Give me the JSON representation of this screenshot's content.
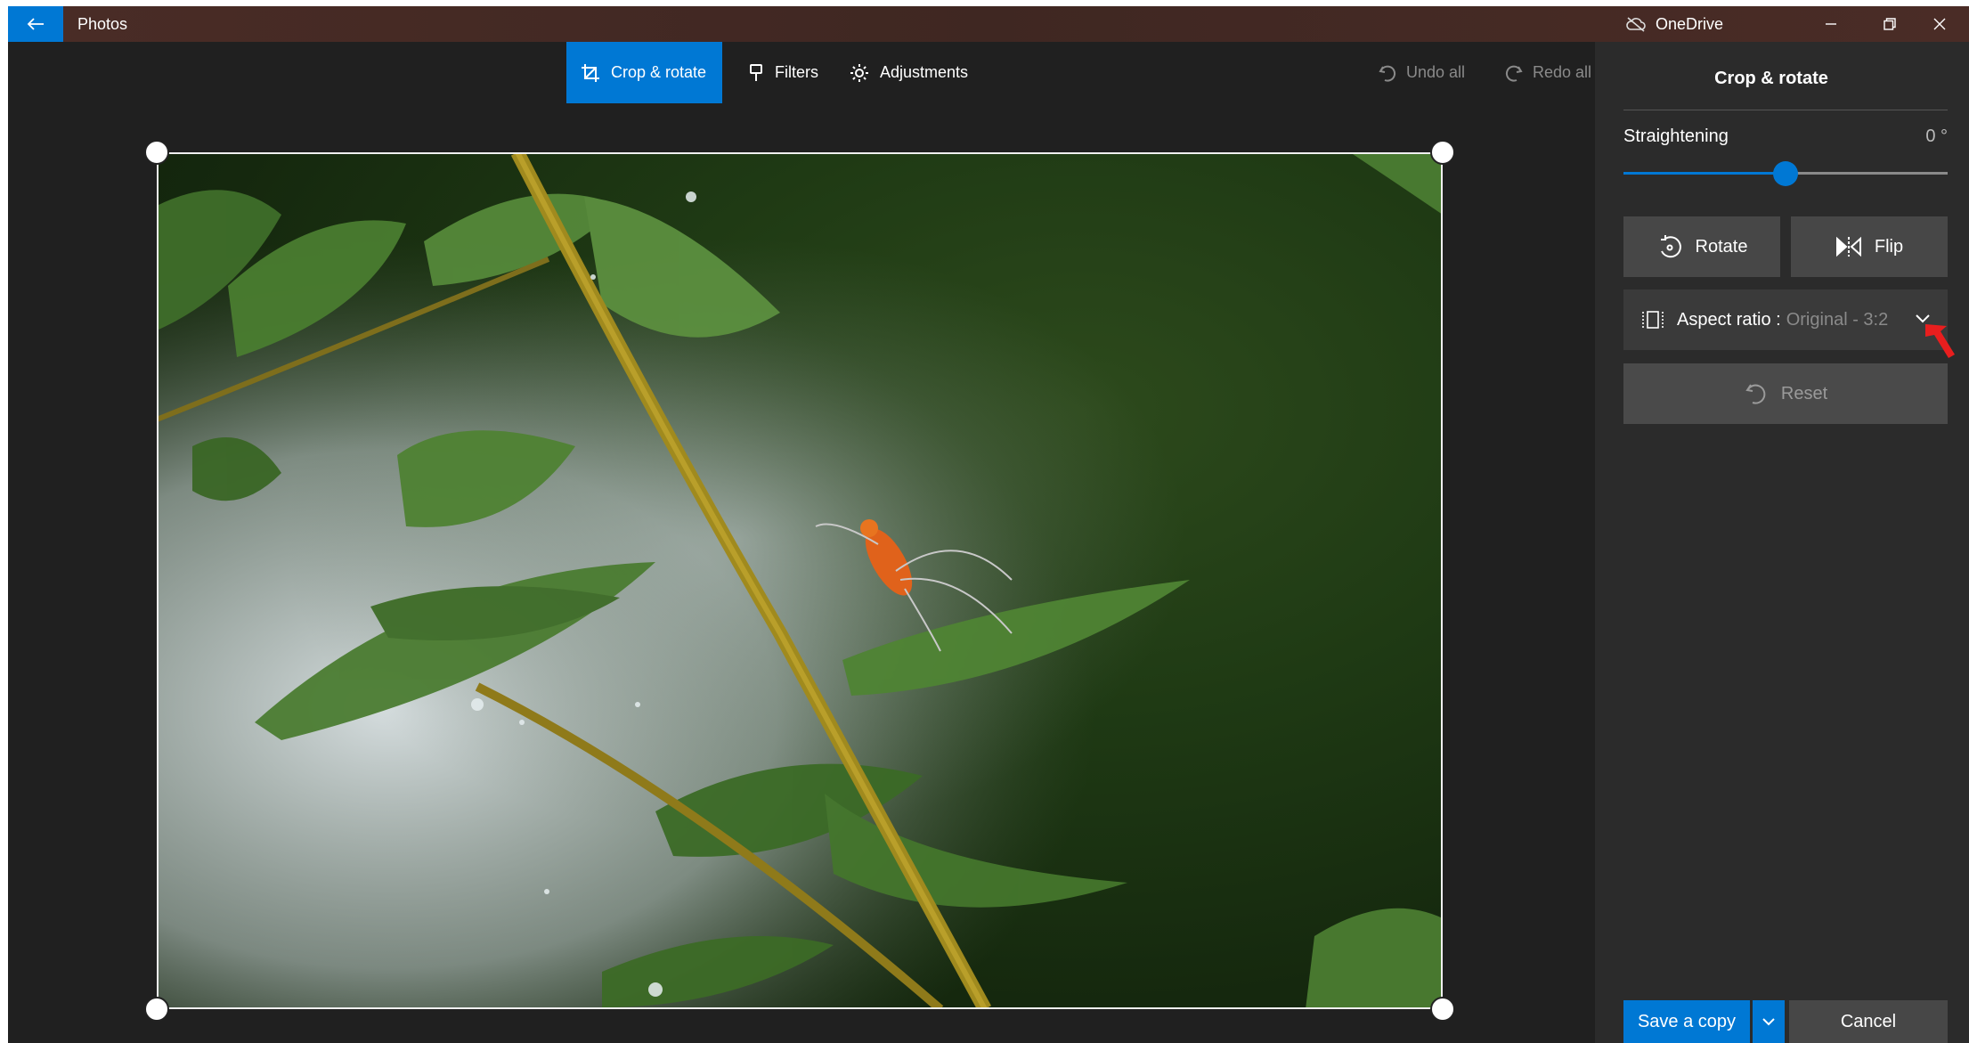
{
  "window": {
    "app_title": "Photos",
    "onedrive_label": "OneDrive",
    "icons": [
      "back-arrow-icon",
      "cloud-off-icon",
      "minimize-icon",
      "restore-icon",
      "close-icon"
    ]
  },
  "toolbar": {
    "tabs": [
      {
        "label": "Crop & rotate",
        "icon": "crop-icon",
        "active": true
      },
      {
        "label": "Filters",
        "icon": "brush-icon",
        "active": false
      },
      {
        "label": "Adjustments",
        "icon": "sun-icon",
        "active": false
      }
    ],
    "undo_all": "Undo all",
    "redo_all": "Redo all"
  },
  "panel": {
    "title": "Crop & rotate",
    "straightening": {
      "label": "Straightening",
      "value": "0 °",
      "position": 0.5
    },
    "rotate_label": "Rotate",
    "flip_label": "Flip",
    "aspect": {
      "label": "Aspect ratio :",
      "value": "Original - 3:2"
    },
    "reset_label": "Reset",
    "save_label": "Save a copy",
    "cancel_label": "Cancel"
  },
  "colors": {
    "accent": "#0078d4",
    "panel_bg": "#2b2b2b",
    "canvas_bg": "#202020",
    "titlebar": "#4a2c26"
  }
}
